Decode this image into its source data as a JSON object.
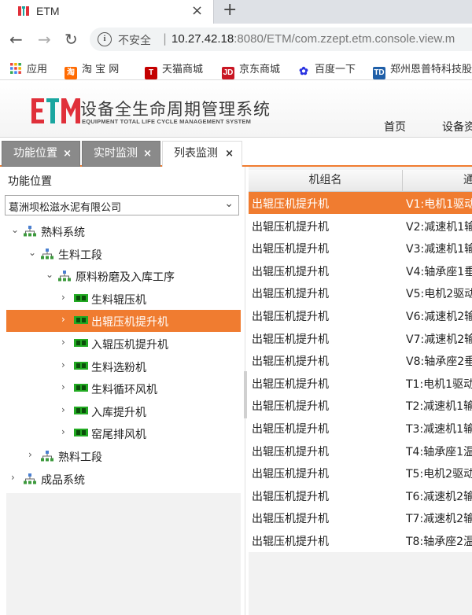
{
  "browser": {
    "tab_title": "ETM",
    "tab_close": "×",
    "new_tab": "+",
    "insecure_label": "不安全",
    "url_host": "10.27.42.18",
    "url_rest": ":8080/ETM/com.zzept.etm.console.view.m",
    "back": "←",
    "forward": "→",
    "reload": "↻"
  },
  "bookmarks": [
    {
      "label": "应用",
      "icon": "apps-grid-icon",
      "color": "#e8453c"
    },
    {
      "label": "淘 宝 网",
      "icon": "taobao-icon",
      "color": "#ff6a00"
    },
    {
      "label": "天猫商城",
      "icon": "tmall-icon",
      "color": "#c40000"
    },
    {
      "label": "京东商城",
      "icon": "jd-icon",
      "color": "#c91623"
    },
    {
      "label": "百度一下",
      "icon": "baidu-paw-icon",
      "color": "#2932e1"
    },
    {
      "label": "郑州恩普特科技股",
      "icon": "td-icon",
      "color": "#1f5fa8"
    }
  ],
  "app": {
    "title": "设备全生命周期管理系统",
    "subtitle": "EQUIPMENT TOTAL LIFE CYCLE MANAGEMENT SYSTEM",
    "logo_text": "ETM",
    "nav": [
      "首页",
      "设备资"
    ]
  },
  "work_tabs": [
    {
      "label": "功能位置",
      "active": false
    },
    {
      "label": "实时监测",
      "active": false
    },
    {
      "label": "列表监测",
      "active": true
    }
  ],
  "tab_close_glyph": "×",
  "left": {
    "title": "功能位置",
    "company": "葛洲坝松滋水泥有限公司",
    "tree": [
      {
        "label": "熟料系统",
        "level": 0,
        "expanded": true,
        "icon": "org-tree-icon",
        "selected": false
      },
      {
        "label": "生料工段",
        "level": 1,
        "expanded": true,
        "icon": "org-tree-icon",
        "selected": false
      },
      {
        "label": "原料粉磨及入库工序",
        "level": 2,
        "expanded": true,
        "icon": "org-tree-icon",
        "selected": false
      },
      {
        "label": "生料辊压机",
        "level": 3,
        "expanded": false,
        "icon": "machine-icon",
        "selected": false
      },
      {
        "label": "出辊压机提升机",
        "level": 3,
        "expanded": false,
        "icon": "machine-icon",
        "selected": true
      },
      {
        "label": "入辊压机提升机",
        "level": 3,
        "expanded": false,
        "icon": "machine-icon",
        "selected": false
      },
      {
        "label": "生料选粉机",
        "level": 3,
        "expanded": false,
        "icon": "machine-icon",
        "selected": false
      },
      {
        "label": "生料循环风机",
        "level": 3,
        "expanded": false,
        "icon": "machine-icon",
        "selected": false
      },
      {
        "label": "入库提升机",
        "level": 3,
        "expanded": false,
        "icon": "machine-icon",
        "selected": false
      },
      {
        "label": "窑尾排风机",
        "level": 3,
        "expanded": false,
        "icon": "machine-icon",
        "selected": false
      },
      {
        "label": "熟料工段",
        "level": 1,
        "expanded": false,
        "icon": "org-tree-icon",
        "selected": false
      },
      {
        "label": "成品系统",
        "level": 0,
        "expanded": false,
        "icon": "org-tree-icon",
        "selected": false
      }
    ]
  },
  "table": {
    "headers": [
      "机组名",
      "通"
    ],
    "rows": [
      {
        "unit": "出辊压机提升机",
        "point": "V1:电机1驱动",
        "selected": true
      },
      {
        "unit": "出辊压机提升机",
        "point": "V2:减速机1输",
        "selected": false
      },
      {
        "unit": "出辊压机提升机",
        "point": "V3:减速机1输",
        "selected": false
      },
      {
        "unit": "出辊压机提升机",
        "point": "V4:轴承座1垂",
        "selected": false
      },
      {
        "unit": "出辊压机提升机",
        "point": "V5:电机2驱动",
        "selected": false
      },
      {
        "unit": "出辊压机提升机",
        "point": "V6:减速机2输",
        "selected": false
      },
      {
        "unit": "出辊压机提升机",
        "point": "V7:减速机2输",
        "selected": false
      },
      {
        "unit": "出辊压机提升机",
        "point": "V8:轴承座2垂",
        "selected": false
      },
      {
        "unit": "出辊压机提升机",
        "point": "T1:电机1驱动",
        "selected": false
      },
      {
        "unit": "出辊压机提升机",
        "point": "T2:减速机1输",
        "selected": false
      },
      {
        "unit": "出辊压机提升机",
        "point": "T3:减速机1输",
        "selected": false
      },
      {
        "unit": "出辊压机提升机",
        "point": "T4:轴承座1温",
        "selected": false
      },
      {
        "unit": "出辊压机提升机",
        "point": "T5:电机2驱动",
        "selected": false
      },
      {
        "unit": "出辊压机提升机",
        "point": "T6:减速机2输",
        "selected": false
      },
      {
        "unit": "出辊压机提升机",
        "point": "T7:减速机2输",
        "selected": false
      },
      {
        "unit": "出辊压机提升机",
        "point": "T8:轴承座2温",
        "selected": false
      }
    ]
  },
  "colors": {
    "accent": "#f07c30",
    "tab_inactive": "#8a8a8a",
    "machine_green": "#22aa22",
    "tree_icon_green": "#3c9a3c",
    "logo_red": "#e0303a",
    "logo_teal": "#1aa6a0"
  }
}
